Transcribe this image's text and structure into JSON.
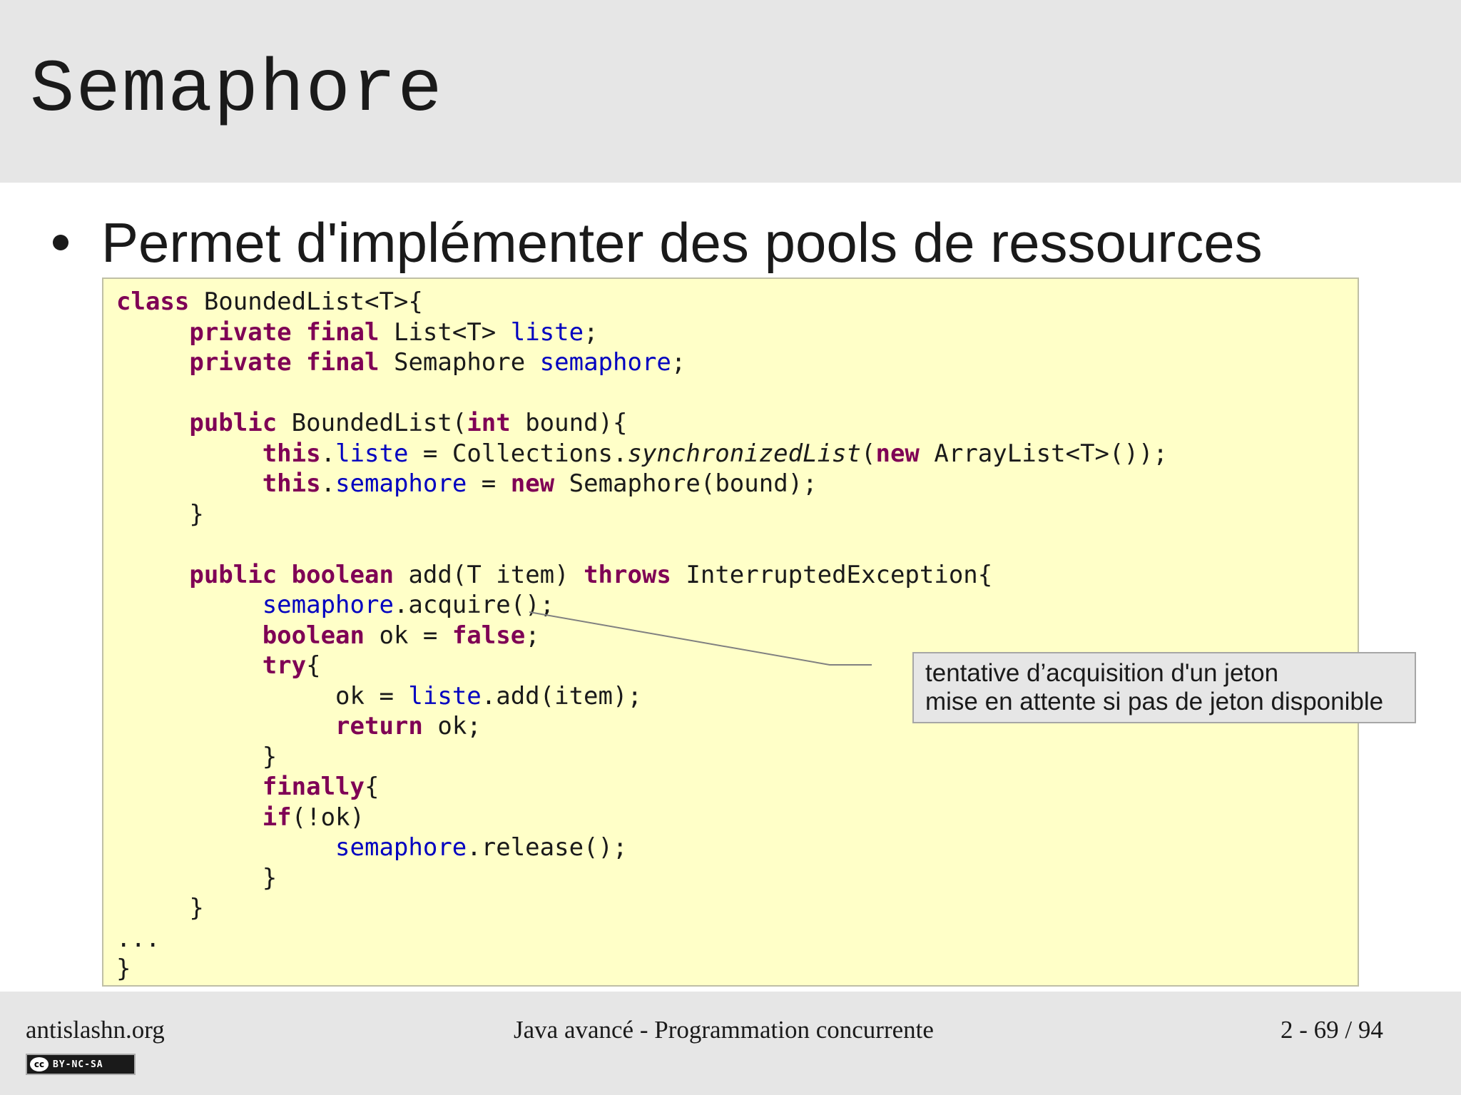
{
  "slide": {
    "title": "Semaphore",
    "bullet": "Permet d'implémenter des pools de ressources"
  },
  "code": {
    "lines": [
      [
        [
          "kw",
          "class"
        ],
        [
          "t",
          " BoundedList<T>{"
        ]
      ],
      [
        [
          "t",
          "     "
        ],
        [
          "kw",
          "private"
        ],
        [
          "t",
          " "
        ],
        [
          "kw",
          "final"
        ],
        [
          "t",
          " List<T> "
        ],
        [
          "field",
          "liste"
        ],
        [
          "t",
          ";"
        ]
      ],
      [
        [
          "t",
          "     "
        ],
        [
          "kw",
          "private"
        ],
        [
          "t",
          " "
        ],
        [
          "kw",
          "final"
        ],
        [
          "t",
          " Semaphore "
        ],
        [
          "field",
          "semaphore"
        ],
        [
          "t",
          ";"
        ]
      ],
      [],
      [
        [
          "t",
          "     "
        ],
        [
          "kw",
          "public"
        ],
        [
          "t",
          " BoundedList("
        ],
        [
          "kw",
          "int"
        ],
        [
          "t",
          " bound){"
        ]
      ],
      [
        [
          "t",
          "          "
        ],
        [
          "kw",
          "this"
        ],
        [
          "t",
          "."
        ],
        [
          "field",
          "liste"
        ],
        [
          "t",
          " = Collections."
        ],
        [
          "static",
          "synchronizedList"
        ],
        [
          "t",
          "("
        ],
        [
          "kw",
          "new"
        ],
        [
          "t",
          " ArrayList<T>());"
        ]
      ],
      [
        [
          "t",
          "          "
        ],
        [
          "kw",
          "this"
        ],
        [
          "t",
          "."
        ],
        [
          "field",
          "semaphore"
        ],
        [
          "t",
          " = "
        ],
        [
          "kw",
          "new"
        ],
        [
          "t",
          " Semaphore(bound);"
        ]
      ],
      [
        [
          "t",
          "     }"
        ]
      ],
      [],
      [
        [
          "t",
          "     "
        ],
        [
          "kw",
          "public"
        ],
        [
          "t",
          " "
        ],
        [
          "kw",
          "boolean"
        ],
        [
          "t",
          " add(T item) "
        ],
        [
          "kw",
          "throws"
        ],
        [
          "t",
          " InterruptedException{"
        ]
      ],
      [
        [
          "t",
          "          "
        ],
        [
          "field",
          "semaphore"
        ],
        [
          "t",
          ".acquire();"
        ]
      ],
      [
        [
          "t",
          "          "
        ],
        [
          "kw",
          "boolean"
        ],
        [
          "t",
          " ok = "
        ],
        [
          "kw",
          "false"
        ],
        [
          "t",
          ";"
        ]
      ],
      [
        [
          "t",
          "          "
        ],
        [
          "kw",
          "try"
        ],
        [
          "t",
          "{"
        ]
      ],
      [
        [
          "t",
          "               ok = "
        ],
        [
          "field",
          "liste"
        ],
        [
          "t",
          ".add(item);"
        ]
      ],
      [
        [
          "t",
          "               "
        ],
        [
          "kw",
          "return"
        ],
        [
          "t",
          " ok;"
        ]
      ],
      [
        [
          "t",
          "          }"
        ]
      ],
      [
        [
          "t",
          "          "
        ],
        [
          "kw",
          "finally"
        ],
        [
          "t",
          "{"
        ]
      ],
      [
        [
          "t",
          "          "
        ],
        [
          "kw",
          "if"
        ],
        [
          "t",
          "(!ok)"
        ]
      ],
      [
        [
          "t",
          "               "
        ],
        [
          "field",
          "semaphore"
        ],
        [
          "t",
          ".release();"
        ]
      ],
      [
        [
          "t",
          "          }"
        ]
      ],
      [
        [
          "t",
          "     }"
        ]
      ],
      [
        [
          "t",
          "..."
        ]
      ],
      [
        [
          "t",
          "}"
        ]
      ]
    ]
  },
  "callout": {
    "line1": "tentative d’acquisition d'un jeton",
    "line2": "mise en attente si pas de jeton disponible"
  },
  "footer": {
    "site": "antislashn.org",
    "course": "Java avancé - Programmation concurrente",
    "page": "2 - 69 / 94",
    "license_badge": "BY-NC-SA",
    "license_cc": "cc"
  },
  "colors": {
    "keyword": "#7f0055",
    "field": "#0000c0",
    "code_background": "#ffffc8",
    "bar_background": "#e6e6e6"
  }
}
